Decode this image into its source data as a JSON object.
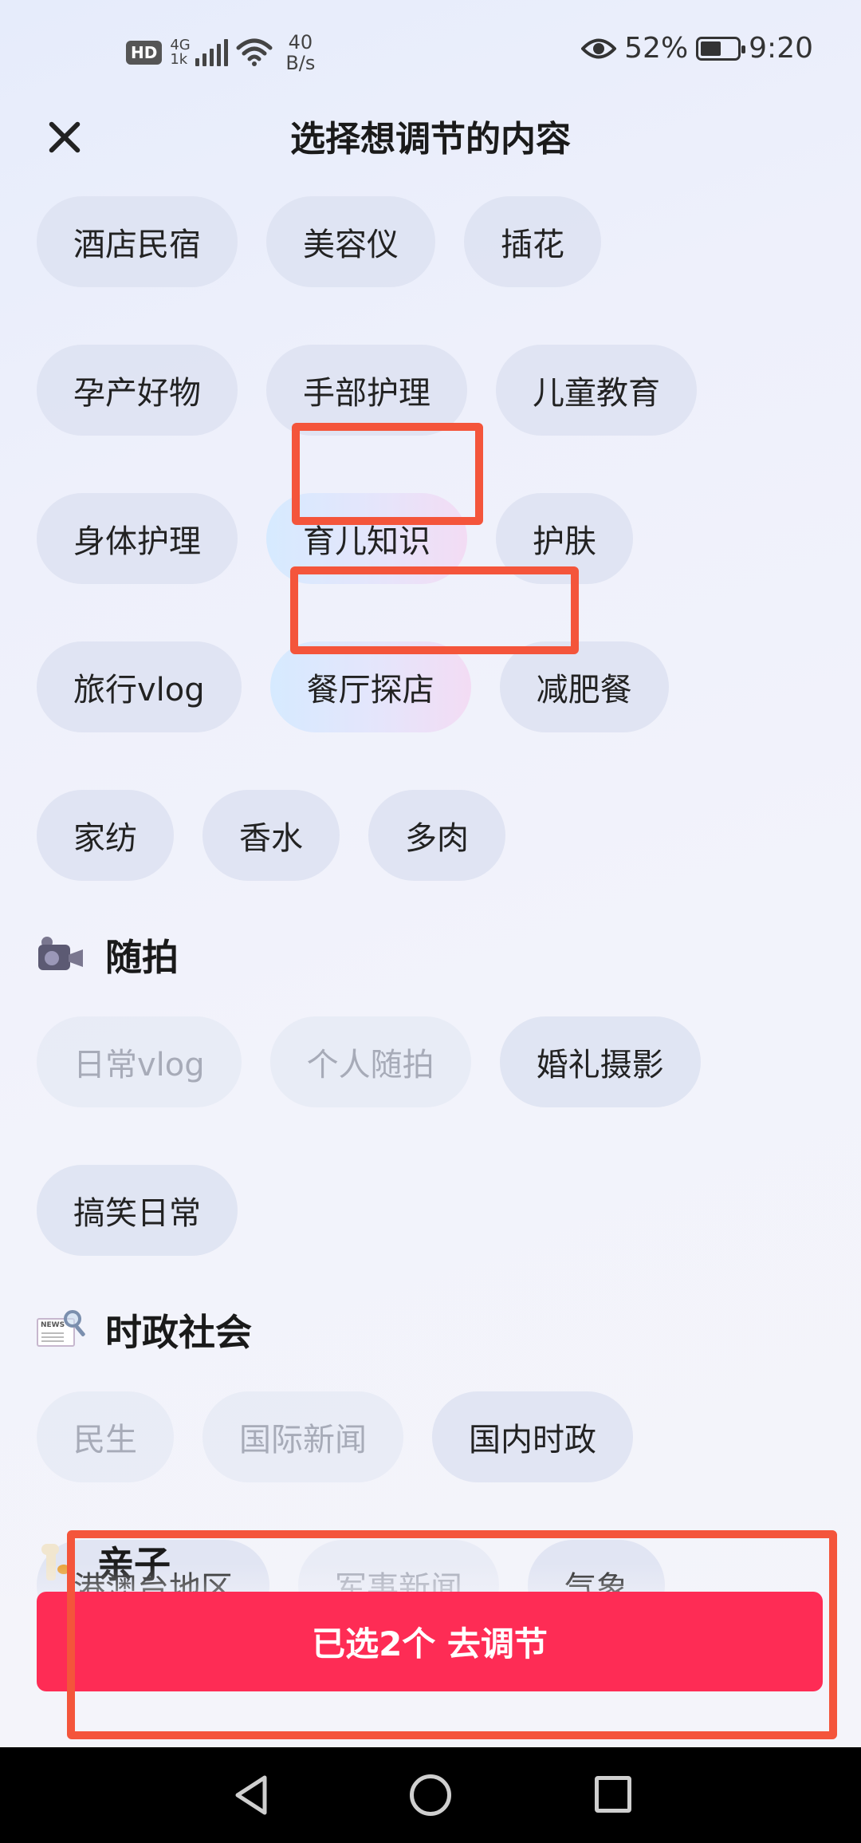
{
  "status_bar": {
    "hd": "HD",
    "network_type": "4G",
    "network_sub": "1k",
    "net_speed_value": "40",
    "net_speed_unit": "B/s",
    "battery_percent": "52%",
    "time": "9:20"
  },
  "header": {
    "title": "选择想调节的内容"
  },
  "sections": {
    "top": {
      "chips": [
        {
          "label": "酒店民宿",
          "state": "normal"
        },
        {
          "label": "美容仪",
          "state": "normal"
        },
        {
          "label": "插花",
          "state": "normal"
        },
        {
          "label": "孕产好物",
          "state": "normal"
        },
        {
          "label": "手部护理",
          "state": "normal"
        },
        {
          "label": "儿童教育",
          "state": "normal"
        },
        {
          "label": "身体护理",
          "state": "normal"
        },
        {
          "label": "育儿知识",
          "state": "selected"
        },
        {
          "label": "护肤",
          "state": "normal"
        },
        {
          "label": "旅行vlog",
          "state": "normal"
        },
        {
          "label": "餐厅探店",
          "state": "selected"
        },
        {
          "label": "减肥餐",
          "state": "normal"
        },
        {
          "label": "家纺",
          "state": "normal"
        },
        {
          "label": "香水",
          "state": "normal"
        },
        {
          "label": "多肉",
          "state": "normal"
        }
      ]
    },
    "suipai": {
      "title": "随拍",
      "icon": "video-camera-icon",
      "chips": [
        {
          "label": "日常vlog",
          "state": "disabled"
        },
        {
          "label": "个人随拍",
          "state": "disabled"
        },
        {
          "label": "婚礼摄影",
          "state": "normal"
        },
        {
          "label": "搞笑日常",
          "state": "normal"
        }
      ]
    },
    "shizheng": {
      "title": "时政社会",
      "icon": "newspaper-magnifier-icon",
      "icon_text": "NEWS",
      "chips": [
        {
          "label": "民生",
          "state": "disabled"
        },
        {
          "label": "国际新闻",
          "state": "disabled"
        },
        {
          "label": "国内时政",
          "state": "normal"
        },
        {
          "label": "港澳台地区",
          "state": "normal"
        },
        {
          "label": "军事新闻",
          "state": "disabled"
        },
        {
          "label": "气象",
          "state": "normal"
        }
      ]
    },
    "qinzi": {
      "title": "亲子",
      "icon": "giraffe-icon"
    }
  },
  "confirm_button": {
    "label": "已选2个 去调节"
  },
  "colors": {
    "accent": "#fe2c55",
    "annotation": "#f4553b",
    "chip_bg": "#dde2f1",
    "disabled_text": "#a7abb8"
  }
}
